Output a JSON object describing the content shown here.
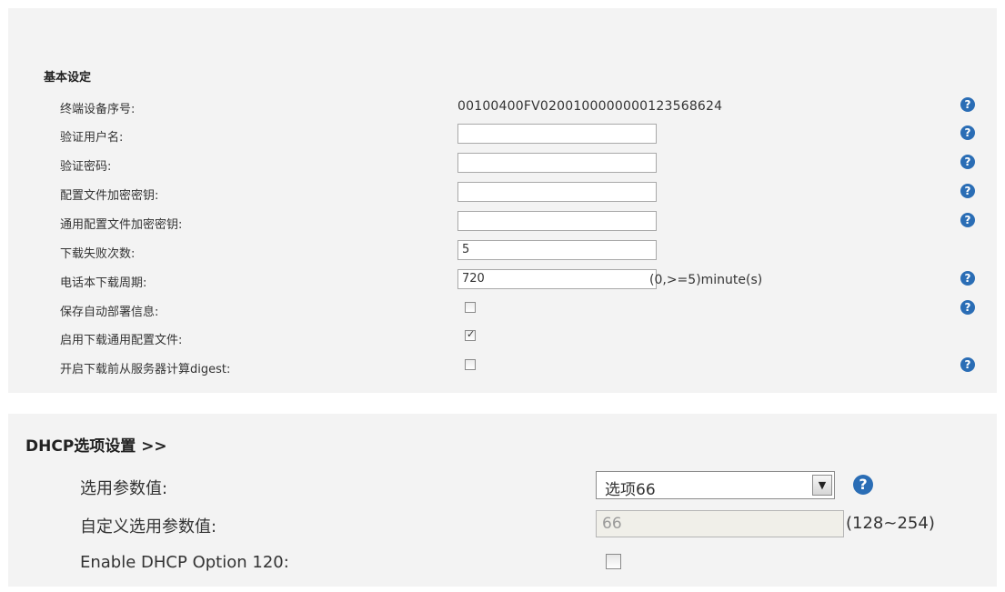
{
  "basic": {
    "title": "基本设定",
    "rows": [
      {
        "label": "终端设备序号:",
        "value": "00100400FV0200100000000123568624"
      },
      {
        "label": "验证用户名:",
        "value": ""
      },
      {
        "label": "验证密码:",
        "value": ""
      },
      {
        "label": "配置文件加密密钥:",
        "value": ""
      },
      {
        "label": "通用配置文件加密密钥:",
        "value": ""
      },
      {
        "label": "下载失败次数:",
        "value": "5"
      },
      {
        "label": "电话本下载周期:",
        "value": "720",
        "suffix": "(0,>=5)minute(s)"
      },
      {
        "label": "保存自动部署信息:",
        "checked": false
      },
      {
        "label": "启用下载通用配置文件:",
        "checked": true
      },
      {
        "label": "开启下载前从服务器计算digest:",
        "checked": false
      }
    ]
  },
  "dhcp": {
    "title": "DHCP选项设置 >>",
    "option_label": "选用参数值:",
    "option_selected": "选项66",
    "custom_label": "自定义选用参数值:",
    "custom_value": "66",
    "custom_suffix": "(128~254)",
    "option120_label": "Enable DHCP Option 120:",
    "option120_checked": false
  },
  "icons": {
    "help": "?",
    "dropdown": "▼",
    "help_color": "#2a6db5"
  }
}
